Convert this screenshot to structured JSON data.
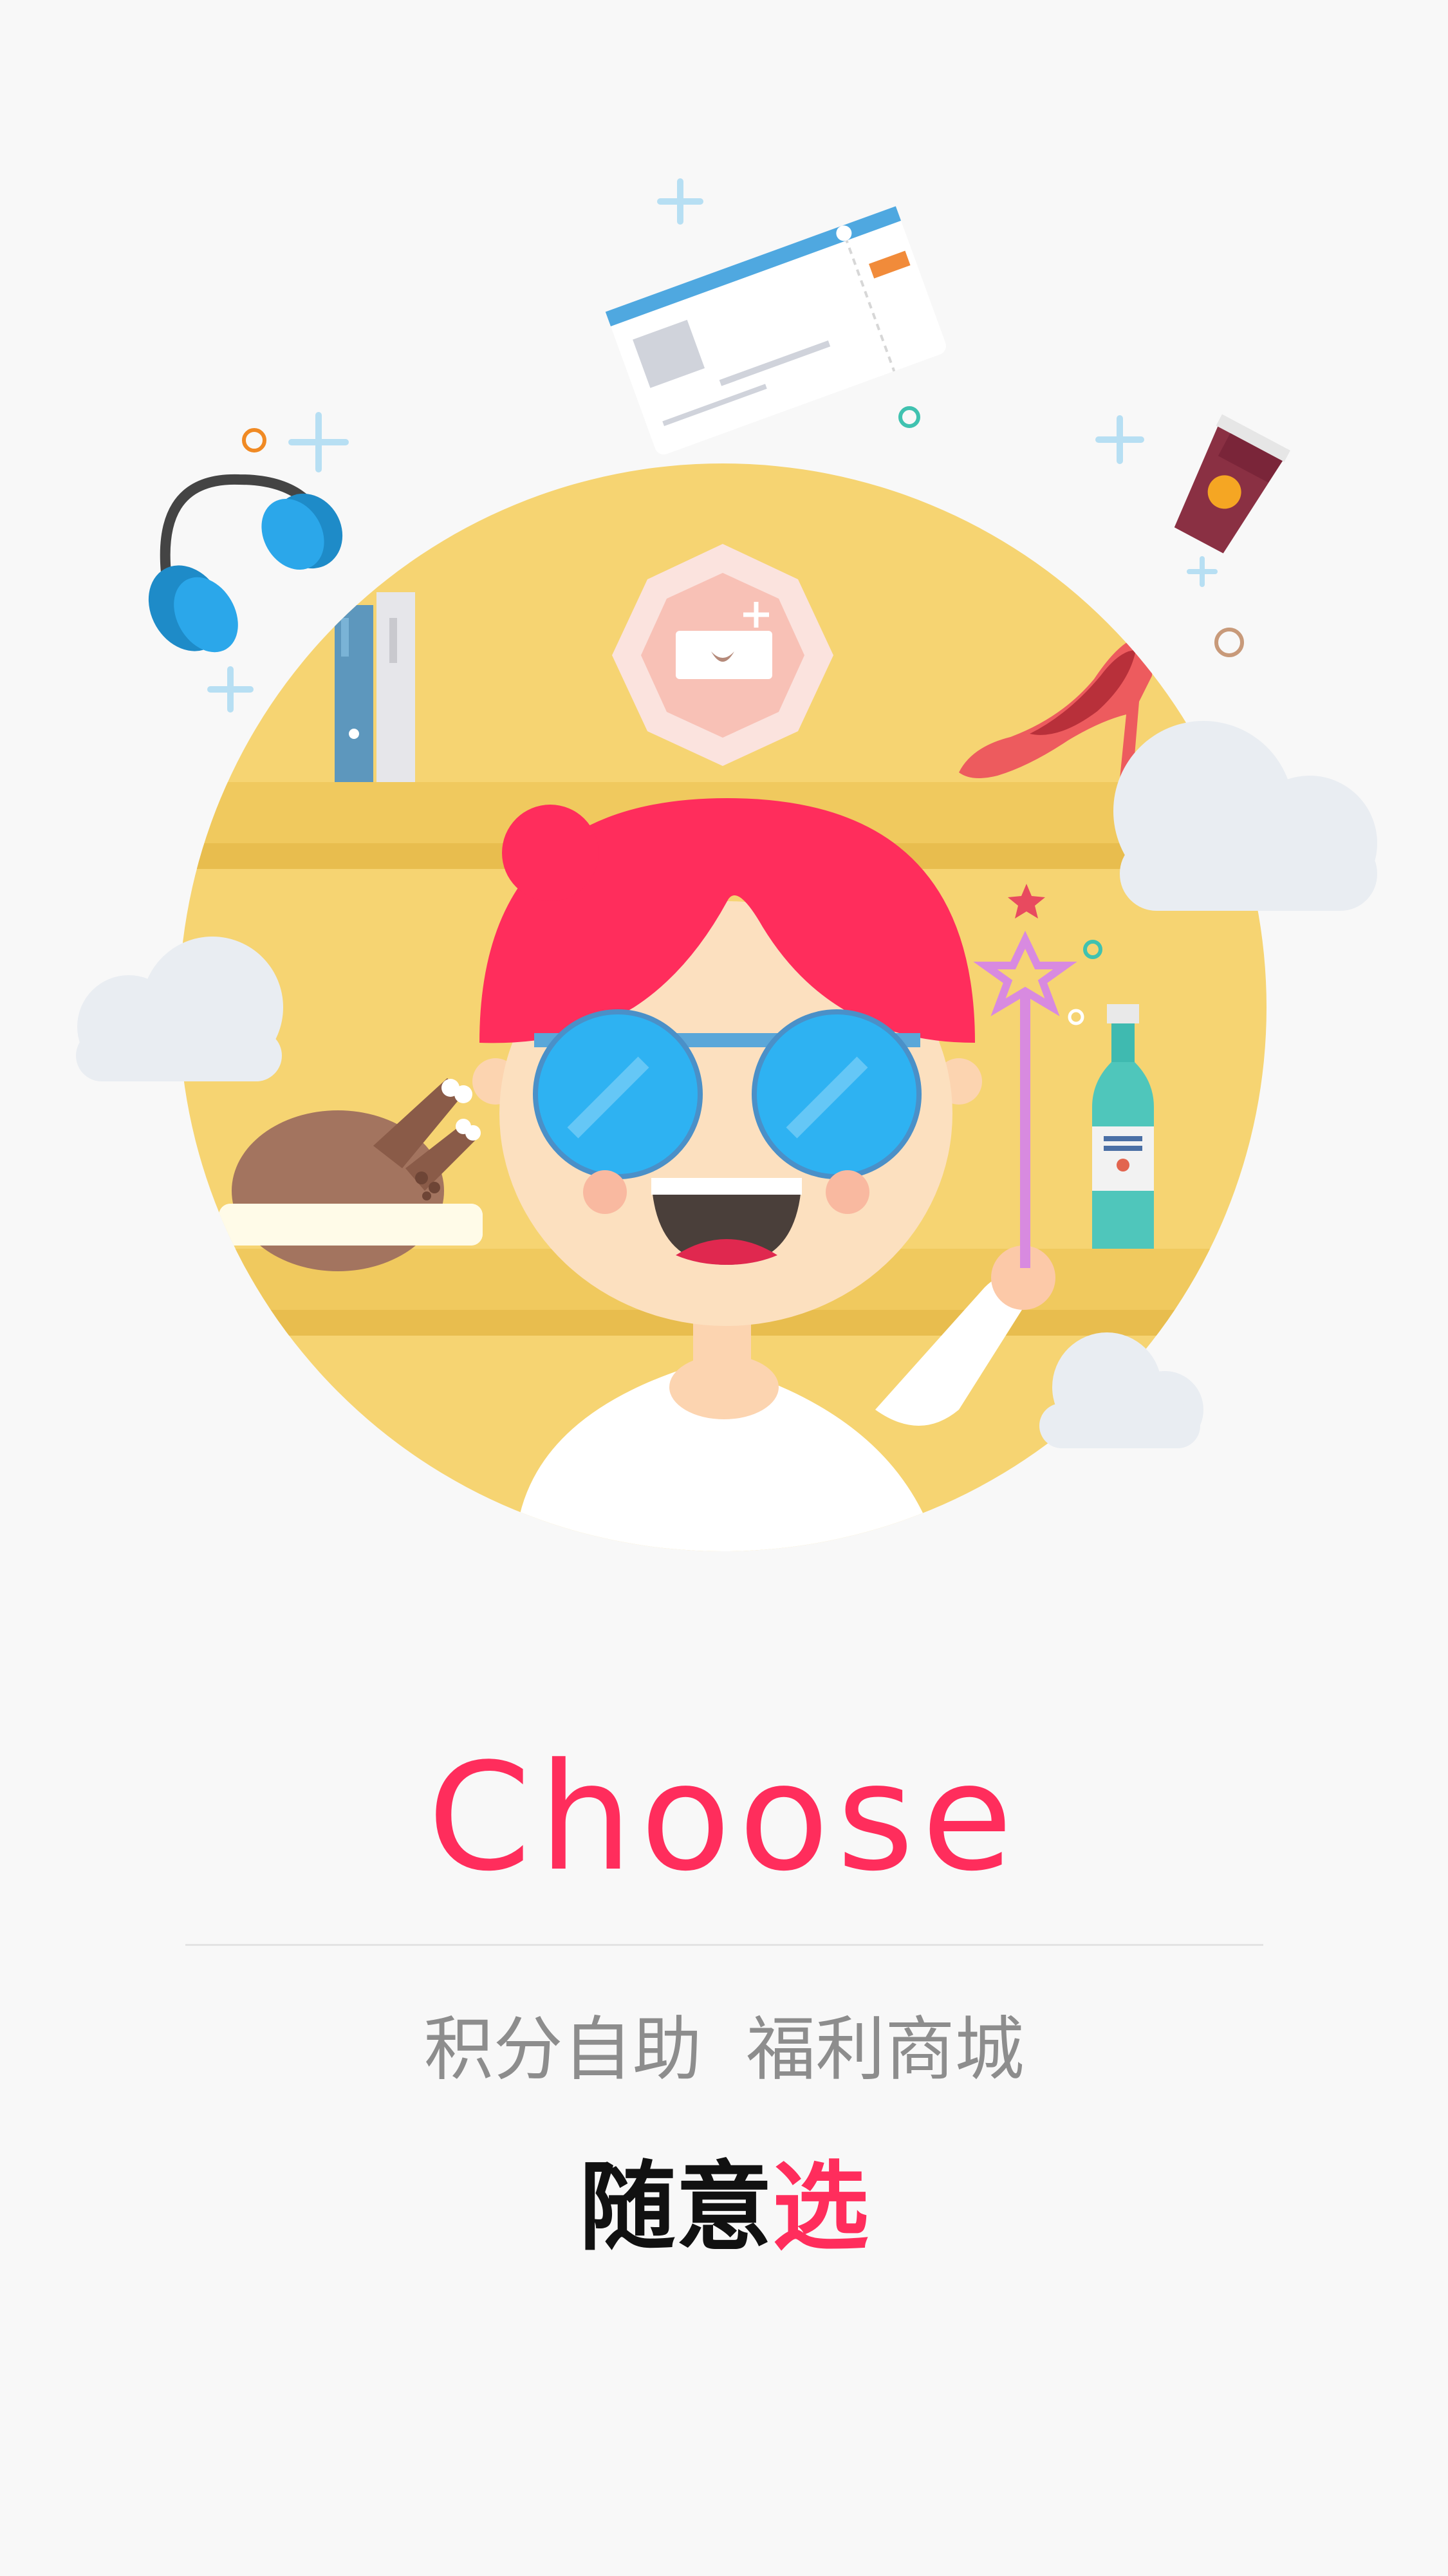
{
  "screen": {
    "headline": "Choose",
    "subtitle": "积分自助  福利商城",
    "tagline_plain": "随意",
    "tagline_accent": "选"
  },
  "illustration": {
    "icons": [
      "ticket-icon",
      "headphones-icon",
      "coffee-cup-icon",
      "high-heel-icon",
      "wine-bottle-icon",
      "roast-chicken-icon",
      "magic-wand-icon",
      "gift-badge-icon",
      "books-icon",
      "cloud-icon"
    ]
  },
  "colors": {
    "accent": "#ff2d5c",
    "background": "#f8f8f8",
    "circle": "#f6d472",
    "shelf": "#efc75a",
    "hair": "#ff2d5c",
    "glasses": "#2eb2f2"
  }
}
